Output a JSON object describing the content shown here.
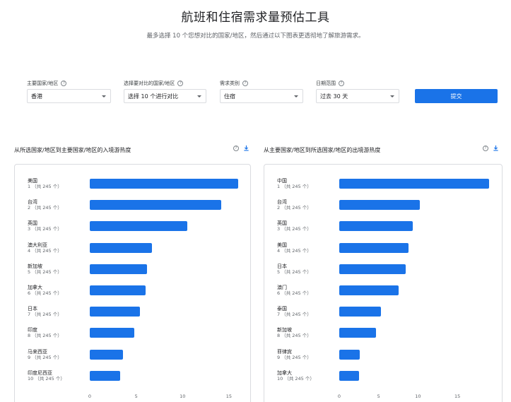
{
  "header": {
    "title": "航班和住宿需求量预估工具",
    "subtitle": "最多选择 10 个您想对比的国家/地区，然后通过以下图表更透彻地了解旅游需求。"
  },
  "filters": {
    "primary_country": {
      "label": "主要国家/地区",
      "value": "香港"
    },
    "compare_countries": {
      "label": "选择要对比的国家/地区",
      "value": "选择 10 个进行对比"
    },
    "demand_type": {
      "label": "需求类别",
      "value": "住宿"
    },
    "date_range": {
      "label": "日期范围",
      "value": "过去 30 天"
    },
    "submit_label": "提交"
  },
  "colors": {
    "bar": "#1a73e8",
    "accent": "#1a73e8"
  },
  "chart_data": [
    {
      "type": "bar",
      "title": "从所选国家/地区到主要国家/地区的入境游热度",
      "categories": [
        "美国",
        "台湾",
        "英国",
        "澳大利亚",
        "新加坡",
        "加拿大",
        "日本",
        "印度",
        "马来西亚",
        "印度尼西亚"
      ],
      "ranks": [
        "1 （共 245 个）",
        "2 （共 245 个）",
        "3 （共 245 个）",
        "4 （共 245 个）",
        "5 （共 245 个）",
        "6 （共 245 个）",
        "7 （共 245 个）",
        "8 （共 245 个）",
        "9 （共 245 个）",
        "10 （共 245 个）"
      ],
      "values": [
        16,
        14.2,
        10.5,
        6.7,
        6.2,
        6.0,
        5.4,
        4.8,
        3.6,
        3.3
      ],
      "xticks": [
        0,
        5,
        10,
        15
      ],
      "xlim": [
        0,
        16.3
      ]
    },
    {
      "type": "bar",
      "title": "从主要国家/地区到所选国家/地区的出境游热度",
      "categories": [
        "中国",
        "台湾",
        "英国",
        "美国",
        "日本",
        "澳门",
        "泰国",
        "新加坡",
        "菲律宾",
        "加拿大"
      ],
      "ranks": [
        "1 （共 245 个）",
        "2 （共 245 个）",
        "3 （共 245 个）",
        "4 （共 245 个）",
        "5 （共 245 个）",
        "6 （共 245 个）",
        "7 （共 245 个）",
        "8 （共 245 个）",
        "9 （共 245 个）",
        "10 （共 245 个）"
      ],
      "values": [
        19,
        10.2,
        9.3,
        8.8,
        8.4,
        7.5,
        5.3,
        4.7,
        2.6,
        2.5
      ],
      "xticks": [
        0,
        5,
        10,
        15
      ],
      "xlim": [
        0,
        19.3
      ]
    }
  ]
}
